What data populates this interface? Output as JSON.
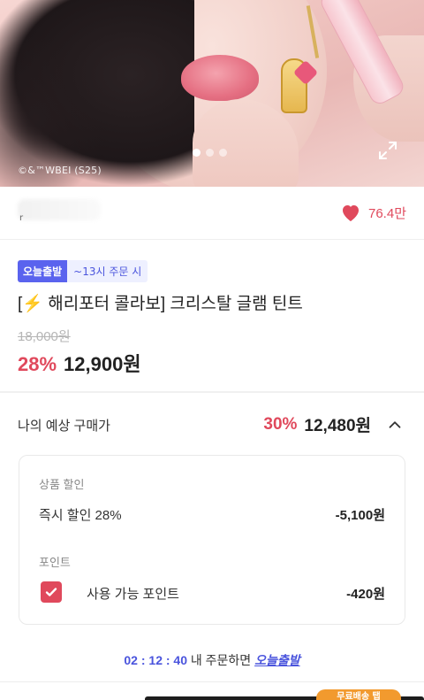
{
  "hero": {
    "copyright": "©&™WBEI (S25)",
    "carousel": {
      "count": 3,
      "active_index": 0
    }
  },
  "brand": {
    "name_mark": "r",
    "likes": "76.4만"
  },
  "product": {
    "badge_today": "오늘출발",
    "badge_time": "~13시 주문 시",
    "title_open": "[",
    "title_rest": " 해리포터 콜라보] 크리스탈 글램 틴트",
    "original_price": "18,000원",
    "discount_percent": "28%",
    "sale_price": "12,900원"
  },
  "expected_price": {
    "label": "나의 예상 구매가",
    "discount_percent": "30%",
    "price": "12,480원"
  },
  "discount_panel": {
    "product_discount_label": "상품 할인",
    "instant_discount_label": "즉시 할인 28%",
    "instant_discount_value": "-5,100원",
    "point_label": "포인트",
    "usable_point_label": "사용 가능 포인트",
    "usable_point_value": "-420원",
    "point_checked": true
  },
  "countdown": {
    "time": "02 : 12 : 40",
    "text": " 내 주문하면 ",
    "brand": "오늘출발"
  },
  "bottom": {
    "tag": "무료배송 탭"
  },
  "colors": {
    "accent_red": "#e0495c",
    "accent_blue": "#4a54dd",
    "badge_blue": "#5a63ee"
  }
}
